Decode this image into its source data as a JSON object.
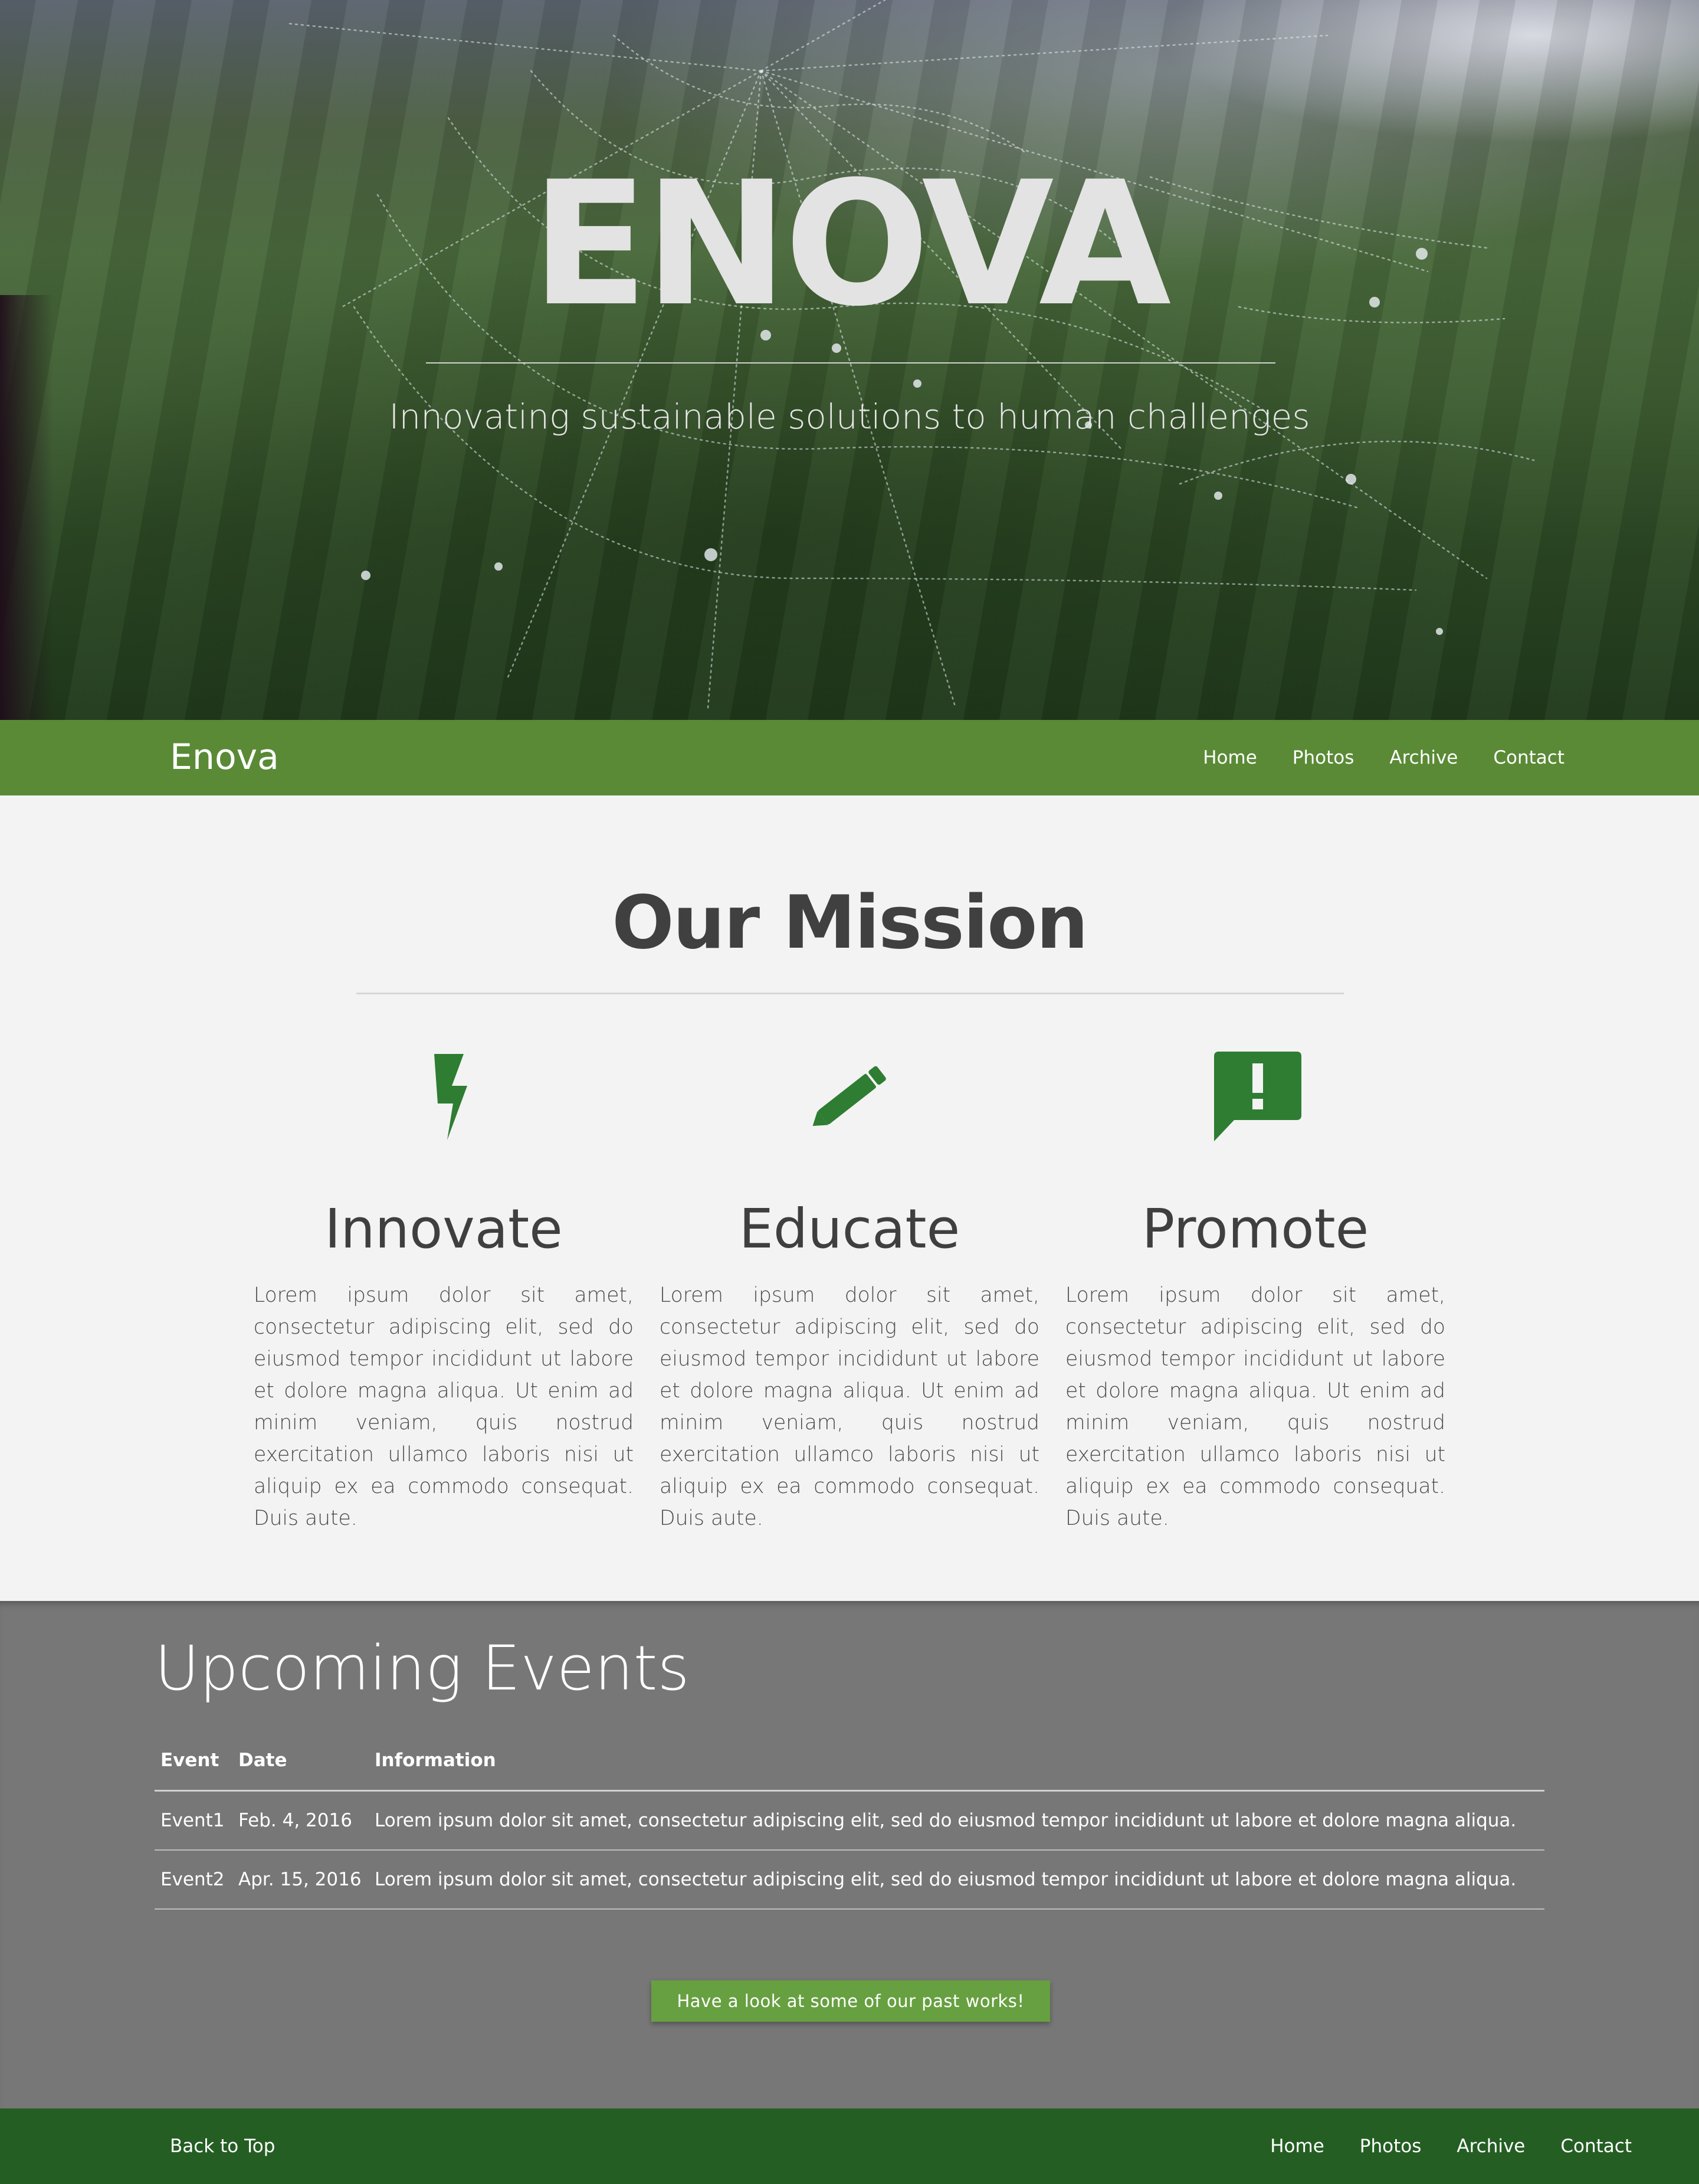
{
  "hero": {
    "title": "ENOVA",
    "subtitle": "Innovating sustainable solutions to human challenges"
  },
  "navbar": {
    "brand": "Enova",
    "links": [
      "Home",
      "Photos",
      "Archive",
      "Contact"
    ]
  },
  "mission": {
    "title": "Our Mission",
    "columns": [
      {
        "icon": "lightning-bolt-icon",
        "title": "Innovate",
        "text": "Lorem ipsum dolor sit amet, consectetur adipiscing elit, sed do eiusmod tempor incididunt ut labore et dolore magna aliqua. Ut enim ad minim veniam, quis nostrud exercitation ullamco laboris nisi ut aliquip ex ea commodo consequat. Duis aute."
      },
      {
        "icon": "pencil-icon",
        "title": "Educate",
        "text": "Lorem ipsum dolor sit amet, consectetur adipiscing elit, sed do eiusmod tempor incididunt ut labore et dolore magna aliqua. Ut enim ad minim veniam, quis nostrud exercitation ullamco laboris nisi ut aliquip ex ea commodo consequat. Duis aute."
      },
      {
        "icon": "feedback-alert-icon",
        "title": "Promote",
        "text": "Lorem ipsum dolor sit amet, consectetur adipiscing elit, sed do eiusmod tempor incididunt ut labore et dolore magna aliqua. Ut enim ad minim veniam, quis nostrud exercitation ullamco laboris nisi ut aliquip ex ea commodo consequat. Duis aute."
      }
    ]
  },
  "events": {
    "title": "Upcoming Events",
    "headers": [
      "Event",
      "Date",
      "Information"
    ],
    "rows": [
      [
        "Event1",
        "Feb. 4, 2016",
        "Lorem ipsum dolor sit amet, consectetur adipiscing elit, sed do eiusmod tempor incididunt ut labore et dolore magna aliqua."
      ],
      [
        "Event2",
        "Apr. 15, 2016",
        "Lorem ipsum dolor sit amet, consectetur adipiscing elit, sed do eiusmod tempor incididunt ut labore et dolore magna aliqua."
      ]
    ],
    "cta_label": "Have a look at some of our past works!"
  },
  "footer": {
    "back_to_top": "Back to Top",
    "links": [
      "Home",
      "Photos",
      "Archive",
      "Contact"
    ]
  },
  "colors": {
    "navbar": "#5a8a36",
    "icon_green": "#2e7d32",
    "events_bg": "#777777",
    "button": "#67a040",
    "footer": "#245e23"
  }
}
